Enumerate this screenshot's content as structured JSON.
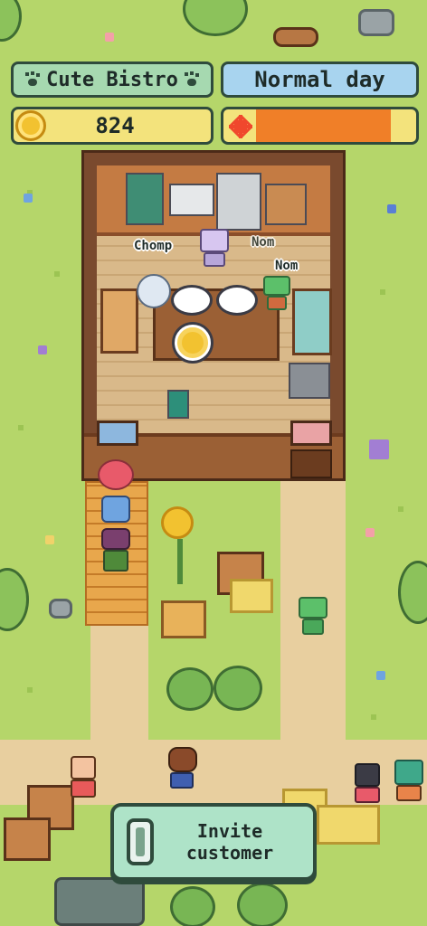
{
  "hud": {
    "restaurant_name": "Cute Bistro",
    "day_type": "Normal day",
    "coins": "824",
    "day_progress": 0.84
  },
  "speech": {
    "bubble_1": "Chomp",
    "bubble_2": "Nom",
    "bubble_3": "Nom"
  },
  "actions": {
    "invite_label": "Invite\ncustomer"
  },
  "icons": {
    "title_left": "paw-icon",
    "title_right": "paw-icon",
    "coins": "coin-icon",
    "day": "sun-icon",
    "invite": "phone-icon"
  },
  "colors": {
    "grass": "#b5d66a",
    "panel_green": "#a6d9b0",
    "panel_blue": "#a8d4ef",
    "bar_yellow": "#f3e37c",
    "bar_orange": "#f07f28",
    "outline": "#2f4b3c"
  }
}
